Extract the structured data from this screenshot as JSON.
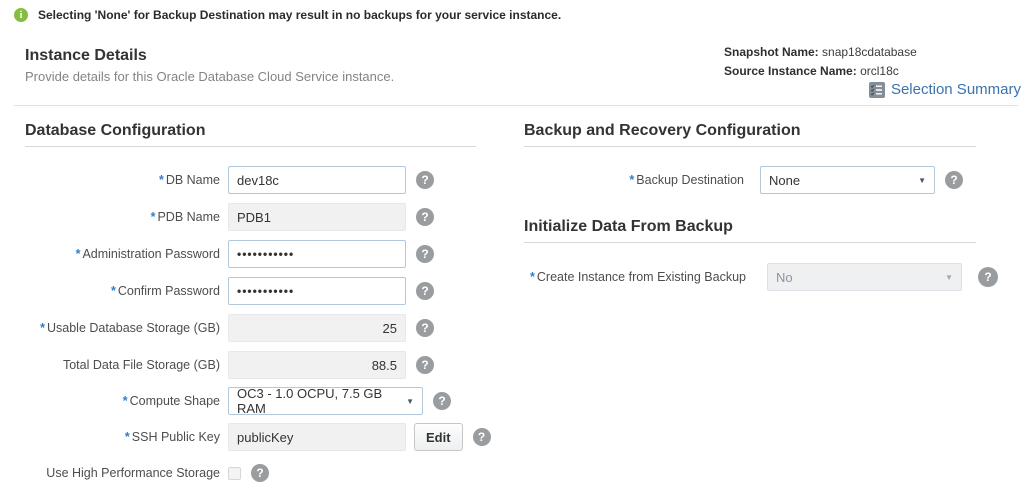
{
  "banner": {
    "text": "Selecting 'None' for Backup Destination may result in no backups for your service instance."
  },
  "header": {
    "title": "Instance Details",
    "subtitle": "Provide details for this Oracle Database Cloud Service instance.",
    "snapshot_label": "Snapshot Name:",
    "snapshot_value": "snap18cdatabase",
    "source_label": "Source Instance Name:",
    "source_value": "orcl18c",
    "selection_summary_label": "Selection Summary"
  },
  "icons": {
    "info": "i",
    "help": "?",
    "dropdown_arrow": "▼"
  },
  "colors": {
    "info_green": "#84bd3f",
    "link_blue": "#3973ac",
    "required_blue": "#2d7ecb",
    "help_gray": "#9a9da0"
  },
  "database_config": {
    "title": "Database Configuration",
    "fields": {
      "db_name": {
        "required": "*",
        "label": "DB Name",
        "value": "dev18c"
      },
      "pdb_name": {
        "required": "*",
        "label": "PDB Name",
        "value": "PDB1"
      },
      "admin_password": {
        "required": "*",
        "label": "Administration Password",
        "value": "•••••••••••"
      },
      "confirm_password": {
        "required": "*",
        "label": "Confirm Password",
        "value": "•••••••••••"
      },
      "usable_storage": {
        "required": "*",
        "label": "Usable Database Storage (GB)",
        "value": "25"
      },
      "total_storage": {
        "label": "Total Data File Storage (GB)",
        "value": "88.5"
      },
      "compute_shape": {
        "required": "*",
        "label": "Compute Shape",
        "value": "OC3 - 1.0 OCPU, 7.5 GB RAM"
      },
      "ssh_key": {
        "required": "*",
        "label": "SSH Public Key",
        "value": "publicKey",
        "button": "Edit"
      },
      "high_perf": {
        "label": "Use High Performance Storage"
      }
    }
  },
  "backup_config": {
    "title": "Backup and Recovery Configuration",
    "fields": {
      "backup_destination": {
        "required": "*",
        "label": "Backup Destination",
        "value": "None"
      }
    }
  },
  "init_backup": {
    "title": "Initialize Data From Backup",
    "fields": {
      "create_from_backup": {
        "required": "*",
        "label": "Create Instance from Existing Backup",
        "value": "No"
      }
    }
  }
}
